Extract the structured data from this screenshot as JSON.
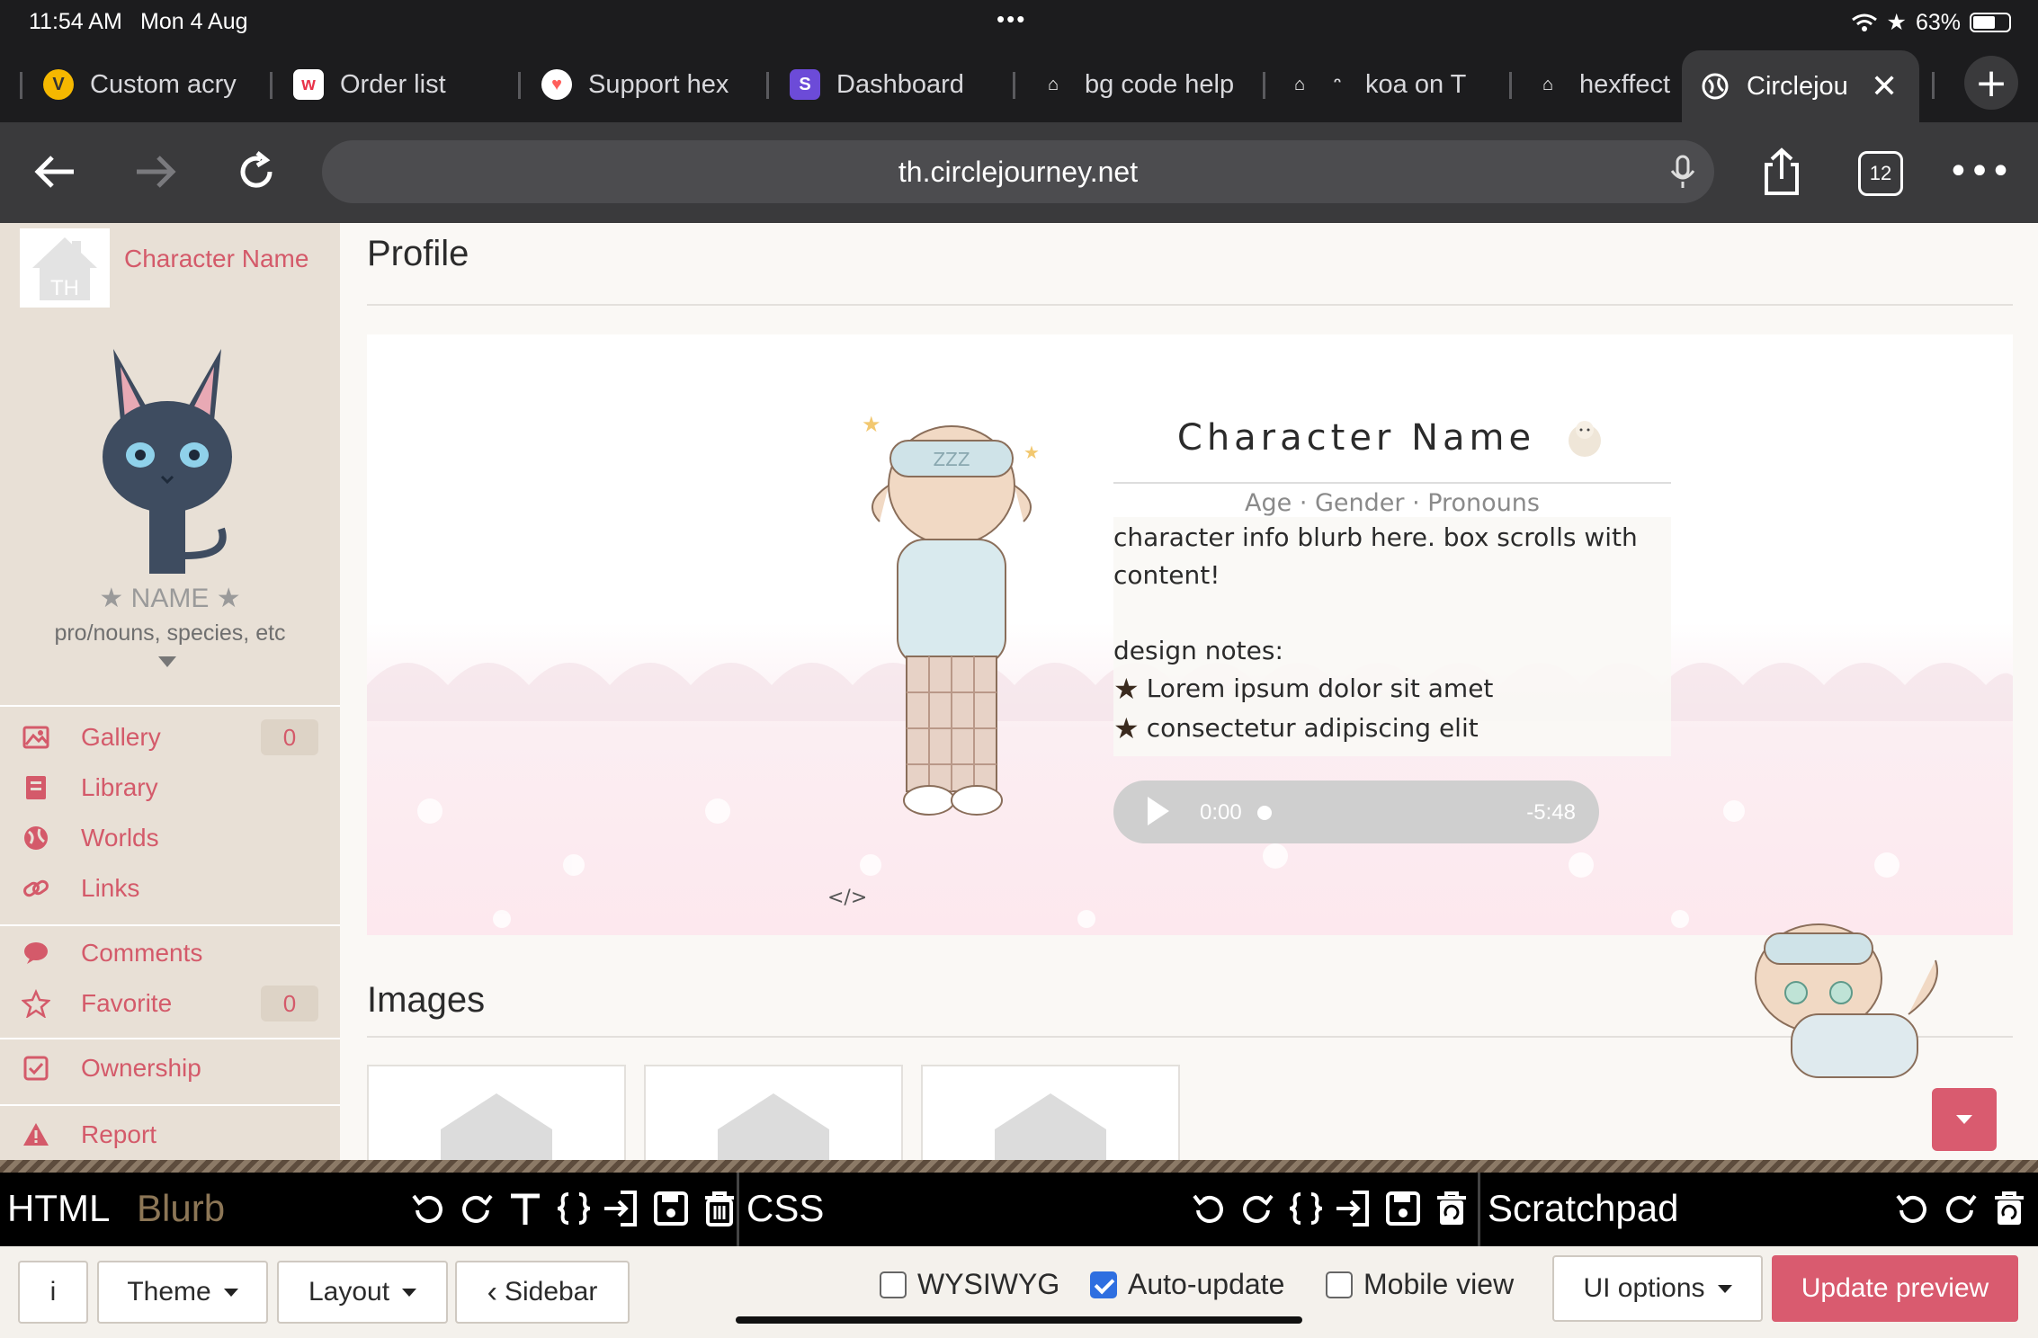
{
  "status_bar": {
    "time": "11:54 AM",
    "date": "Mon 4 Aug",
    "battery": "63%"
  },
  "tabs": [
    {
      "label": "Custom acry",
      "icon": "v-badge-icon",
      "color": "#f5b800"
    },
    {
      "label": "Order list",
      "icon": "w-logo-icon",
      "color": "#e8334a"
    },
    {
      "label": "Support hex",
      "icon": "kofi-cup-icon",
      "color": "#ff5e5b"
    },
    {
      "label": "Dashboard",
      "icon": "s-logo-icon",
      "color": "#6c4bd8"
    },
    {
      "label": "bg code help",
      "icon": "toyhouse-icon",
      "color": "#222222"
    },
    {
      "label": "koa on T",
      "icon": "toyhouse-icon",
      "color": "#222222"
    },
    {
      "label": "hexffect",
      "icon": "toyhouse-icon",
      "color": "#222222"
    },
    {
      "label": "Circlejou",
      "icon": "globe-icon",
      "color": "#ffffff",
      "active": true
    }
  ],
  "toolbar": {
    "url": "th.circlejourney.net",
    "tab_count": "12"
  },
  "sidebar": {
    "character_name": "Character Name",
    "name": "NAME",
    "pronouns": "pro/nouns, species, etc",
    "nav": [
      {
        "label": "Gallery",
        "icon": "image-icon",
        "badge": "0"
      },
      {
        "label": "Library",
        "icon": "book-icon"
      },
      {
        "label": "Worlds",
        "icon": "globe-icon"
      },
      {
        "label": "Links",
        "icon": "link-icon"
      },
      {
        "label": "Comments",
        "icon": "comment-icon"
      },
      {
        "label": "Favorite",
        "icon": "star-icon",
        "badge": "0"
      },
      {
        "label": "Ownership",
        "icon": "checkbox-icon"
      },
      {
        "label": "Report",
        "icon": "warning-icon"
      }
    ]
  },
  "main": {
    "profile_heading": "Profile",
    "images_heading": "Images",
    "character_title": "Character Name",
    "subtitle": "Age · Gender · Pronouns",
    "blurb": "character info blurb here. box scrolls with content!",
    "design_notes_label": "design notes:",
    "notes": [
      "Lorem ipsum dolor sit amet",
      "consectetur adipiscing elit"
    ],
    "player": {
      "current": "0:00",
      "remaining": "-5:48"
    },
    "code_icon_text": "</>"
  },
  "editor": {
    "html_label": "HTML",
    "html_sub": "Blurb",
    "css_label": "CSS",
    "scratch_label": "Scratchpad"
  },
  "bottom": {
    "info": "i",
    "theme": "Theme",
    "layout": "Layout",
    "sidebar": "Sidebar",
    "wysiwyg": "WYSIWYG",
    "wysiwyg_checked": false,
    "autoupdate": "Auto-update",
    "autoupdate_checked": true,
    "mobile": "Mobile view",
    "mobile_checked": false,
    "ui_options": "UI options",
    "update": "Update preview"
  },
  "colors": {
    "accent": "#d95b6f",
    "link": "#d45a6a",
    "sidebar_bg": "#e8e0d6"
  }
}
